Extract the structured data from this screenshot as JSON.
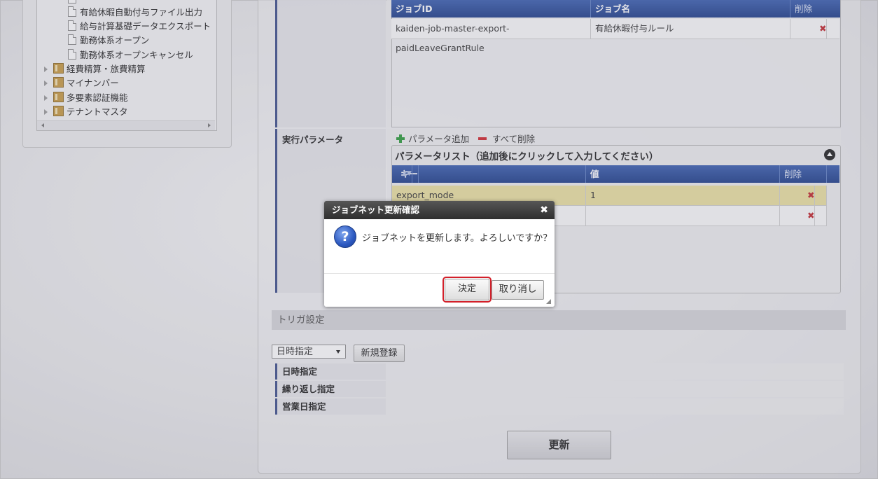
{
  "tree": {
    "items": [
      {
        "label": "有給休暇自動付与ファイル出力",
        "type": "doc"
      },
      {
        "label": "給与計算基礎データエクスポート",
        "type": "doc"
      },
      {
        "label": "勤務体系オープン",
        "type": "doc"
      },
      {
        "label": "勤務体系オープンキャンセル",
        "type": "doc"
      },
      {
        "label": "経費精算・旅費精算",
        "type": "folder"
      },
      {
        "label": "マイナンバー",
        "type": "folder"
      },
      {
        "label": "多要素認証機能",
        "type": "folder"
      },
      {
        "label": "テナントマスタ",
        "type": "folder"
      }
    ]
  },
  "job_grid": {
    "columns": [
      "ジョブID",
      "ジョブ名",
      "削除"
    ],
    "rows": [
      {
        "job_id": "kaiden-job-master-export-paidLeaveGrantRule",
        "job_name": "有給休暇付与ルール"
      }
    ]
  },
  "params": {
    "label": "実行パラメータ",
    "add_label": "パラメータ追加",
    "clear_label": "すべて削除",
    "list_title": "パラメータリスト（追加後にクリックして入力してください）",
    "columns": [
      "キー",
      "値",
      "削除"
    ],
    "rows": [
      {
        "key": "export_mode",
        "value": "1"
      },
      {
        "key": "",
        "value": ""
      }
    ]
  },
  "trigger": {
    "section_title": "トリガ設定",
    "select_value": "日時指定",
    "new_button": "新規登録",
    "rows": [
      "日時指定",
      "繰り返し指定",
      "営業日指定"
    ]
  },
  "update_button": "更新",
  "dialog": {
    "title": "ジョブネット更新確認",
    "message": "ジョブネットを更新します。よろしいですか？",
    "ok_label": "決定",
    "cancel_label": "取り消し",
    "icon_glyph": "?"
  }
}
